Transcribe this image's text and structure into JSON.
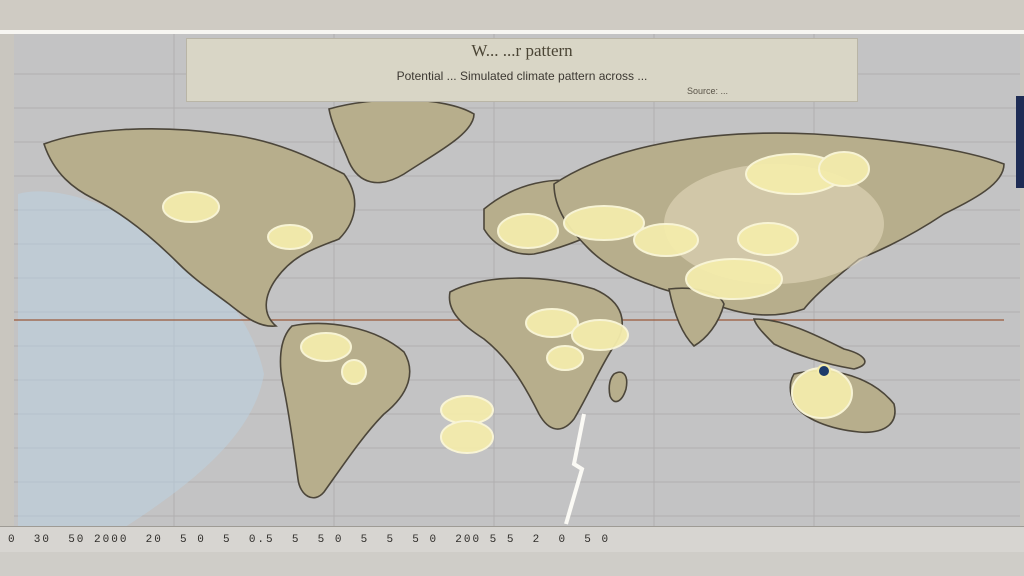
{
  "map": {
    "title": "W... ...r pattern",
    "subtitle": "Potential ... Simulated climate pattern across ...",
    "source": "Source: ...",
    "scale_text": "0  30  50 2000  20  5 0  5  0.5  5  5 0  5  5  5 0  200 5 5  2  0  5 0"
  },
  "colors": {
    "ocean": "#c3c3c4",
    "land": "#b7ae8c",
    "hotspot": "#f4ecac",
    "hotspot_edge": "#fbf7d8"
  },
  "hotspots": [
    {
      "name": "north-america-west"
    },
    {
      "name": "north-america-east"
    },
    {
      "name": "south-america-north"
    },
    {
      "name": "south-america-center"
    },
    {
      "name": "atlantic-south-1"
    },
    {
      "name": "atlantic-south-2"
    },
    {
      "name": "europe-west"
    },
    {
      "name": "europe-central"
    },
    {
      "name": "russia-1"
    },
    {
      "name": "russia-2"
    },
    {
      "name": "middle-east"
    },
    {
      "name": "central-asia"
    },
    {
      "name": "south-asia"
    },
    {
      "name": "africa-north"
    },
    {
      "name": "africa-west"
    },
    {
      "name": "africa-center"
    },
    {
      "name": "australia"
    }
  ]
}
